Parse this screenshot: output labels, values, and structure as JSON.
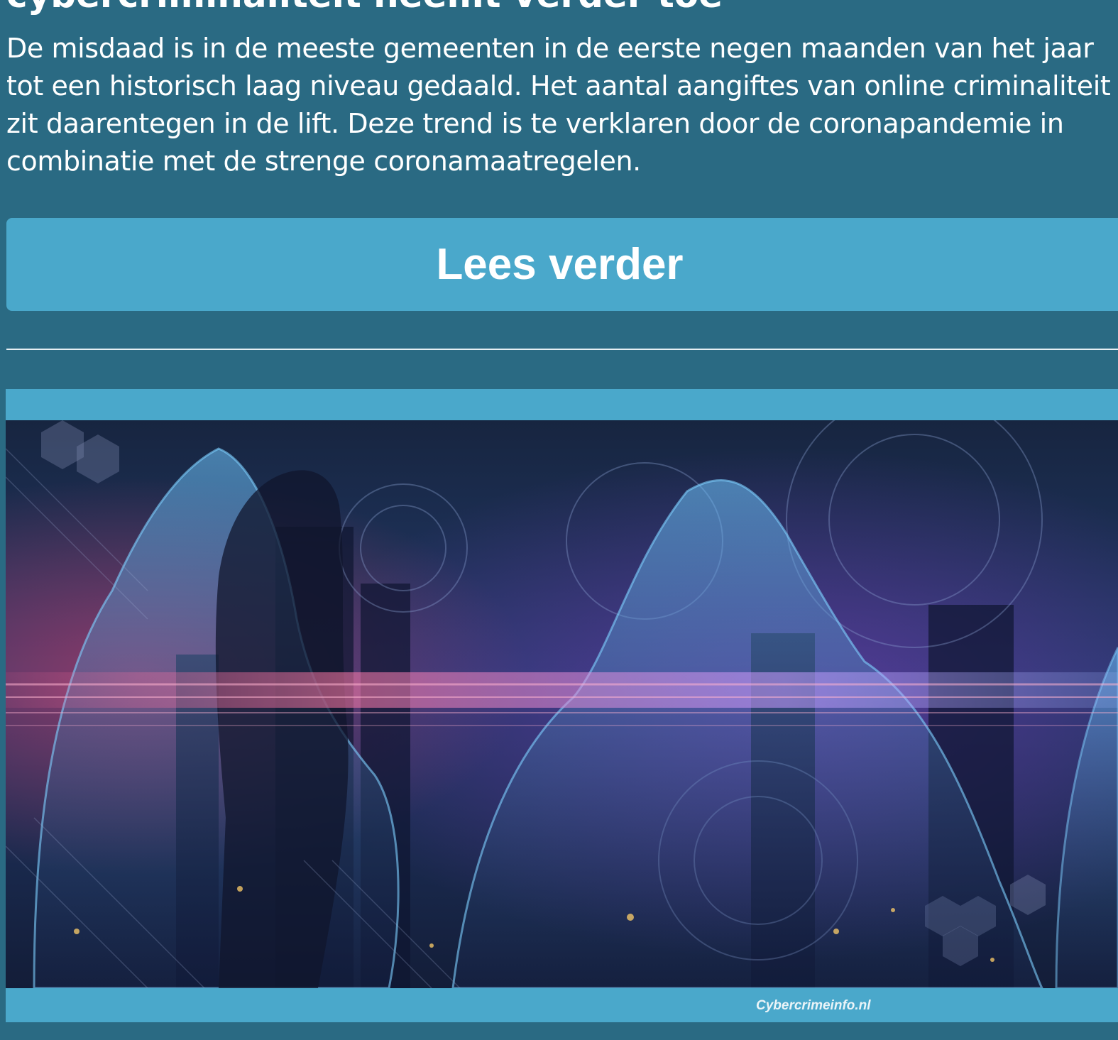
{
  "article": {
    "title": "cybercriminaliteit neemt verder toe",
    "intro": "De misdaad is in de meeste gemeenten in de eerste negen maanden van het jaar tot een historisch laag niveau gedaald. Het aantal aangiftes van online criminaliteit zit daarentegen in de lift. Deze trend is te verklaren door de coronapandemie in combinatie met de strenge coronamaatregelen.",
    "read_more_label": "Lees verder"
  },
  "figure": {
    "image": "hooded-hackers-cybercrime-image",
    "caption": "Cybercrimeinfo.nl"
  },
  "colors": {
    "page_background": "#2a6a83",
    "button_background": "#4aa8cb",
    "text": "#ffffff"
  }
}
